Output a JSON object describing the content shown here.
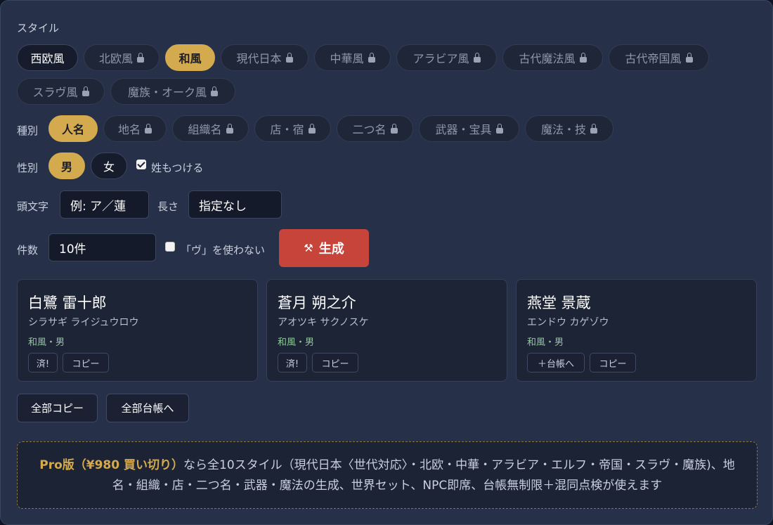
{
  "style_label": "スタイル",
  "styles": [
    {
      "label": "西欧風",
      "state": "on",
      "locked": false
    },
    {
      "label": "北欧風",
      "state": "off",
      "locked": true
    },
    {
      "label": "和風",
      "state": "sel",
      "locked": false
    },
    {
      "label": "現代日本",
      "state": "off",
      "locked": true
    },
    {
      "label": "中華風",
      "state": "off",
      "locked": true
    },
    {
      "label": "アラビア風",
      "state": "off",
      "locked": true
    },
    {
      "label": "古代魔法風",
      "state": "off",
      "locked": true
    },
    {
      "label": "古代帝国風",
      "state": "off",
      "locked": true
    },
    {
      "label": "スラヴ風",
      "state": "off",
      "locked": true
    },
    {
      "label": "魔族・オーク風",
      "state": "off",
      "locked": true
    }
  ],
  "kind_label": "種別",
  "kinds": [
    {
      "label": "人名",
      "state": "sel",
      "locked": false
    },
    {
      "label": "地名",
      "state": "off",
      "locked": true
    },
    {
      "label": "組織名",
      "state": "off",
      "locked": true
    },
    {
      "label": "店・宿",
      "state": "off",
      "locked": true
    },
    {
      "label": "二つ名",
      "state": "off",
      "locked": true
    },
    {
      "label": "武器・宝具",
      "state": "off",
      "locked": true
    },
    {
      "label": "魔法・技",
      "state": "off",
      "locked": true
    }
  ],
  "gender_label": "性別",
  "genders": [
    {
      "label": "男",
      "state": "sel"
    },
    {
      "label": "女",
      "state": "on"
    }
  ],
  "surname_option": {
    "label": "姓もつける",
    "checked": true
  },
  "initial_label": "頭文字",
  "initial_value": "例: ア／蓮",
  "length_label": "長さ",
  "length_value": "指定なし",
  "count_label": "件数",
  "count_value": "10件",
  "no_vu_option": {
    "label": "「ヴ」を使わない",
    "checked": false
  },
  "generate": {
    "icon": "hammer-pick-icon",
    "icon_glyph": "⚒",
    "label": "生成",
    "color": "#c7443b"
  },
  "results": [
    {
      "name": "白鷺 雷十郎",
      "reading": "シラサギ ライジュウロウ",
      "meta": "和風・男",
      "buttons": [
        "済!",
        "コピー"
      ]
    },
    {
      "name": "蒼月 朔之介",
      "reading": "アオツキ サクノスケ",
      "meta": "和風・男",
      "buttons": [
        "済!",
        "コピー"
      ]
    },
    {
      "name": "燕堂 景蔵",
      "reading": "エンドウ カゲゾウ",
      "meta": "和風・男",
      "buttons": [
        "＋台帳へ",
        "コピー"
      ]
    }
  ],
  "bulk": {
    "copy_all": "全部コピー",
    "all_to_ledger": "全部台帳へ"
  },
  "promo": {
    "highlight": "Pro版（¥980 買い切り）",
    "text": "なら全10スタイル（現代日本〈世代対応〉・北欧・中華・アラビア・エルフ・帝国・スラヴ・魔族)、地名・組織・店・二つ名・武器・魔法の生成、世界セット、NPC即席、台帳無制限＋混同点検が使えます"
  },
  "colors": {
    "accent": "#d4aa4e",
    "generate": "#c7443b",
    "meta_text": "#8fc99a",
    "panel": "#263049"
  }
}
